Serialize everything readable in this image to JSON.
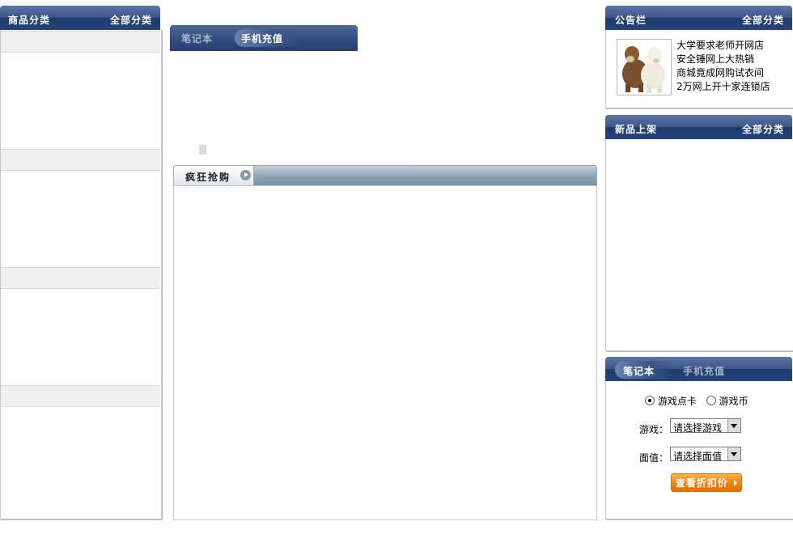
{
  "left": {
    "title": "商品分类",
    "all_link": "全部分类"
  },
  "center": {
    "tabs": [
      {
        "label": "笔记本"
      },
      {
        "label": "手机充值"
      }
    ],
    "crazy_title": "疯狂抢购"
  },
  "right": {
    "notice": {
      "title": "公告栏",
      "all_link": "全部分类",
      "items": [
        "大学要求老师开网店",
        "安全锤网上大热销",
        "商城竟成网购试衣间",
        "2万网上开十家连锁店"
      ]
    },
    "new_products": {
      "title": "新品上架",
      "all_link": "全部分类"
    },
    "recharge": {
      "tabs": [
        {
          "label": "笔记本"
        },
        {
          "label": "手机充值"
        }
      ],
      "radio_game_card": "游戏点卡",
      "radio_game_coin": "游戏币",
      "game_label": "游戏：",
      "game_select": "请选择游戏",
      "value_label": "面值：",
      "value_select": "请选择面值",
      "view_button": "查看折扣价"
    }
  }
}
